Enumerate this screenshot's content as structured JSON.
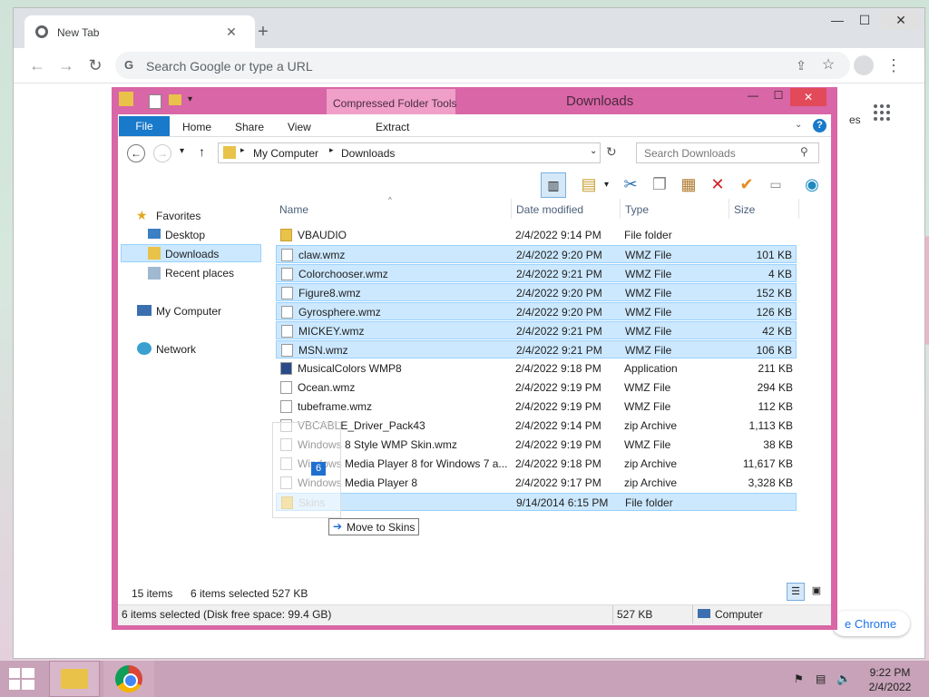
{
  "browser": {
    "tab_title": "New Tab",
    "omnibox_placeholder": "Search Google or type a URL",
    "ntp_partial_text": "es",
    "customize_label": "e Chrome"
  },
  "explorer": {
    "title": "Downloads",
    "contextual_tab": "Compressed Folder Tools",
    "ribbon_tabs": [
      "File",
      "Home",
      "Share",
      "View",
      "Extract"
    ],
    "breadcrumb": [
      "My Computer",
      "Downloads"
    ],
    "search_placeholder": "Search Downloads",
    "nav": {
      "favorites": "Favorites",
      "desktop": "Desktop",
      "downloads": "Downloads",
      "recent": "Recent places",
      "computer": "My Computer",
      "network": "Network"
    },
    "columns": {
      "name": "Name",
      "date": "Date modified",
      "type": "Type",
      "size": "Size"
    },
    "files": [
      {
        "name": "VBAUDIO",
        "date": "2/4/2022 9:14 PM",
        "type": "File folder",
        "size": "",
        "selected": false,
        "icon": "folder-icon"
      },
      {
        "name": "claw.wmz",
        "date": "2/4/2022 9:20 PM",
        "type": "WMZ File",
        "size": "101 KB",
        "selected": true,
        "icon": "file-icon"
      },
      {
        "name": "Colorchooser.wmz",
        "date": "2/4/2022 9:21 PM",
        "type": "WMZ File",
        "size": "4 KB",
        "selected": true,
        "icon": "file-icon"
      },
      {
        "name": "Figure8.wmz",
        "date": "2/4/2022 9:20 PM",
        "type": "WMZ File",
        "size": "152 KB",
        "selected": true,
        "icon": "file-icon"
      },
      {
        "name": "Gyrosphere.wmz",
        "date": "2/4/2022 9:20 PM",
        "type": "WMZ File",
        "size": "126 KB",
        "selected": true,
        "icon": "file-icon"
      },
      {
        "name": "MICKEY.wmz",
        "date": "2/4/2022 9:21 PM",
        "type": "WMZ File",
        "size": "42 KB",
        "selected": true,
        "icon": "file-icon"
      },
      {
        "name": "MSN.wmz",
        "date": "2/4/2022 9:21 PM",
        "type": "WMZ File",
        "size": "106 KB",
        "selected": true,
        "icon": "file-icon"
      },
      {
        "name": "MusicalColors WMP8",
        "date": "2/4/2022 9:18 PM",
        "type": "Application",
        "size": "211 KB",
        "selected": false,
        "icon": "app-icon"
      },
      {
        "name": "Ocean.wmz",
        "date": "2/4/2022 9:19 PM",
        "type": "WMZ File",
        "size": "294 KB",
        "selected": false,
        "icon": "file-icon"
      },
      {
        "name": "tubeframe.wmz",
        "date": "2/4/2022 9:19 PM",
        "type": "WMZ File",
        "size": "112 KB",
        "selected": false,
        "icon": "file-icon"
      },
      {
        "name": "VBCABLE_Driver_Pack43",
        "date": "2/4/2022 9:14 PM",
        "type": "zip Archive",
        "size": "1,113 KB",
        "selected": false,
        "icon": "zip-icon"
      },
      {
        "name": "Windows 8 Style WMP Skin.wmz",
        "date": "2/4/2022 9:19 PM",
        "type": "WMZ File",
        "size": "38 KB",
        "selected": false,
        "icon": "file-icon"
      },
      {
        "name": "Windows Media Player 8 for Windows 7 a...",
        "date": "2/4/2022 9:18 PM",
        "type": "zip Archive",
        "size": "11,617 KB",
        "selected": false,
        "icon": "zip-icon"
      },
      {
        "name": "Windows Media Player 8",
        "date": "2/4/2022 9:17 PM",
        "type": "zip Archive",
        "size": "3,328 KB",
        "selected": false,
        "icon": "zip-icon"
      },
      {
        "name": "Skins",
        "date": "9/14/2014 6:15 PM",
        "type": "File folder",
        "size": "",
        "selected": true,
        "icon": "folder-icon"
      }
    ],
    "drag_count": "6",
    "drag_tooltip": "Move to Skins",
    "status": {
      "items": "15 items",
      "selected": "6 items selected",
      "size": "527 KB"
    },
    "details_bar": {
      "left": "6 items selected (Disk free space: 99.4 GB)",
      "size": "527 KB",
      "location": "Computer"
    }
  },
  "taskbar": {
    "time": "9:22 PM",
    "date": "2/4/2022"
  },
  "colors": {
    "window_frame": "#d966a6",
    "selection": "#cce8ff",
    "file_tab": "#1979ca"
  }
}
